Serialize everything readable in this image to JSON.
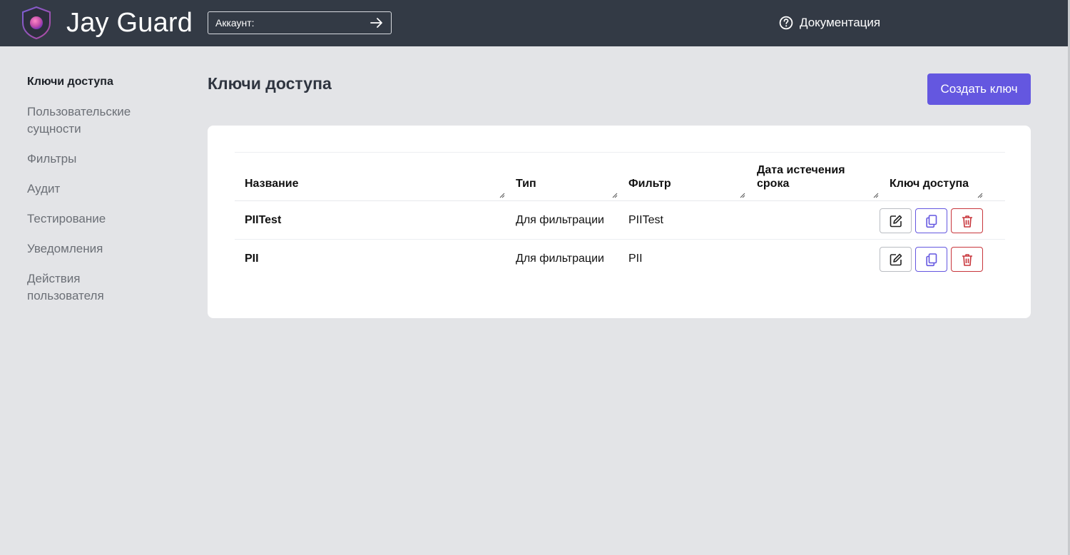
{
  "header": {
    "app_title": "Jay Guard",
    "account_label": "Аккаунт:",
    "docs_label": "Документация"
  },
  "sidebar": {
    "items": [
      {
        "label": "Ключи доступа",
        "active": true
      },
      {
        "label": "Пользовательские сущности",
        "active": false
      },
      {
        "label": "Фильтры",
        "active": false
      },
      {
        "label": "Аудит",
        "active": false
      },
      {
        "label": "Тестирование",
        "active": false
      },
      {
        "label": "Уведомления",
        "active": false
      },
      {
        "label": "Действия пользователя",
        "active": false
      }
    ]
  },
  "main": {
    "title": "Ключи доступа",
    "create_button": "Создать ключ"
  },
  "table": {
    "columns": [
      "Название",
      "Тип",
      "Фильтр",
      "Дата истечения срока",
      "Ключ доступа"
    ],
    "rows": [
      {
        "name": "PIITest",
        "type": "Для фильтрации",
        "filter": "PIITest",
        "expires": ""
      },
      {
        "name": "PII",
        "type": "Для фильтрации",
        "filter": "PII",
        "expires": ""
      }
    ]
  },
  "colors": {
    "topbar": "#333a45",
    "background": "#e3e4e7",
    "accent": "#6457e0",
    "danger": "#c8363c"
  },
  "icons": [
    "shield-logo-icon",
    "arrow-right-icon",
    "help-circle-icon",
    "edit-icon",
    "copy-icon",
    "trash-icon",
    "resize-grip-icon"
  ]
}
